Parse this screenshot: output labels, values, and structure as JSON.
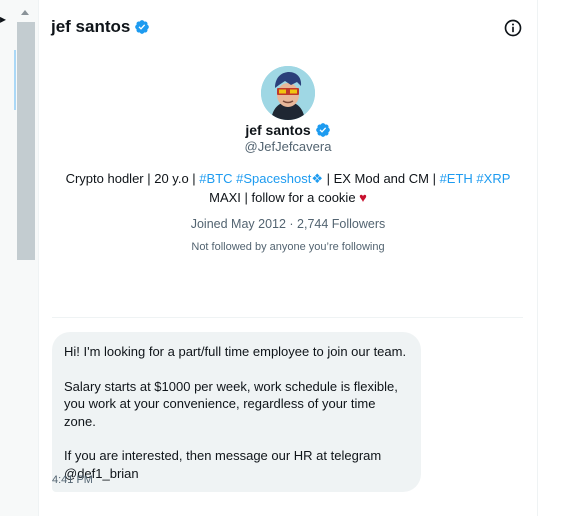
{
  "header": {
    "title": "jef santos",
    "info_icon": "info-circle-icon"
  },
  "profile": {
    "name": "jef santos",
    "handle": "@JefJefcavera",
    "bio": {
      "t1": "Crypto hodler | 20 y.o | ",
      "tag1": "#BTC",
      "tag2": "#Spaceshost",
      "emoji1": "❖",
      "t2": " | EX Mod and CM | ",
      "tag3": "#ETH",
      "tag4": "#XRP",
      "t3": "MAXI | follow for a cookie ",
      "heart": "♥"
    },
    "joined": "Joined May 2012 · 2,744 Followers",
    "not_followed": "Not followed by anyone you’re following"
  },
  "message": {
    "p1": "Hi! I'm looking for a part/full time employee to join our team.",
    "p2": "Salary starts at $1000 per week, work schedule is flexible, you work at your convenience, regardless of your time zone.",
    "p3": "If you are interested, then message our HR at telegram @def1_brian",
    "time": "4:41 PM"
  },
  "colors": {
    "accent": "#1d9bf0",
    "bubble": "#eff3f4",
    "secondary_text": "#536471",
    "heart": "#c8102e"
  }
}
